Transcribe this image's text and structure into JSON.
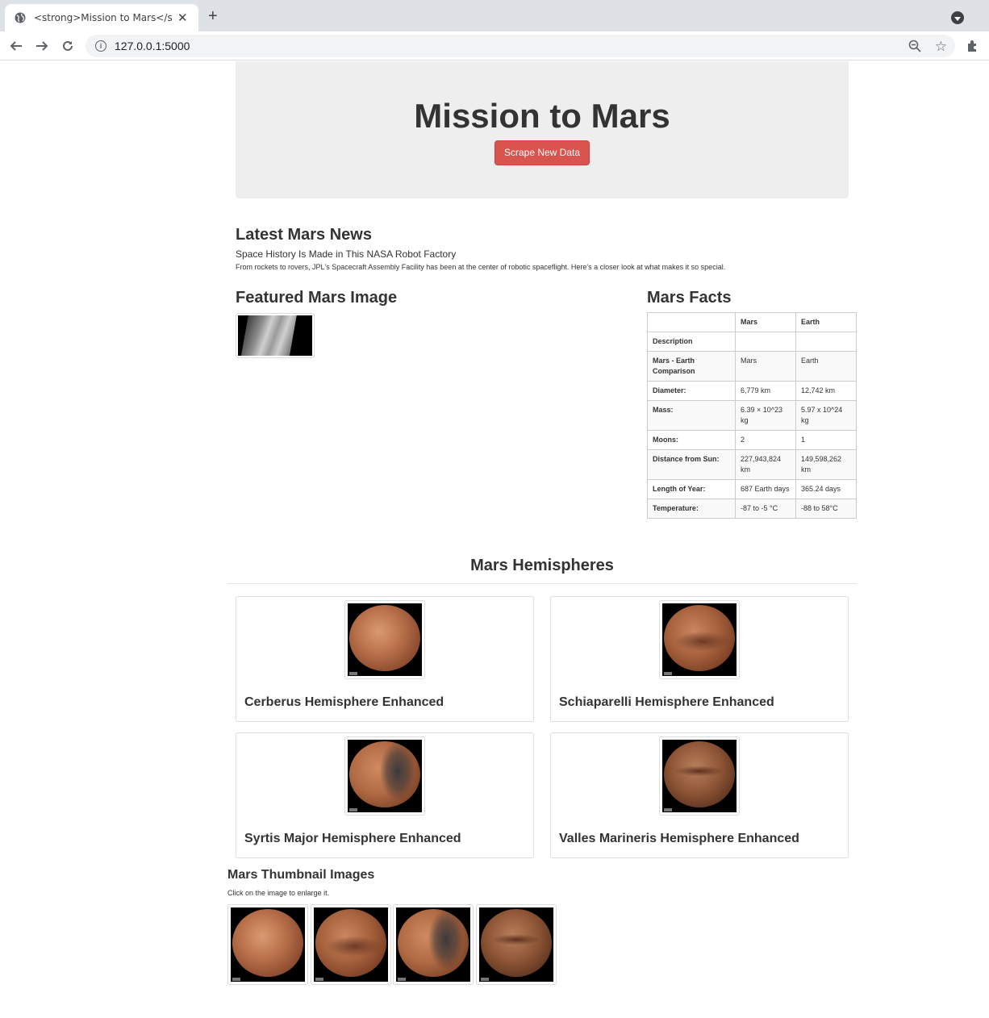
{
  "browser": {
    "tab_title": "<strong>Mission to Mars</strong>",
    "url": "127.0.0.1:5000"
  },
  "jumbotron": {
    "title": "Mission to Mars",
    "button_label": "Scrape New Data"
  },
  "news": {
    "heading": "Latest Mars News",
    "title": "Space History Is Made in This NASA Robot Factory",
    "paragraph": "From rockets to rovers, JPL's Spacecraft Assembly Facility has been at the center of robotic spaceflight. Here's a closer look at what makes it so special."
  },
  "featured": {
    "heading": "Featured Mars Image"
  },
  "facts": {
    "heading": "Mars Facts",
    "columns": [
      "",
      "Mars",
      "Earth"
    ],
    "rows": [
      [
        "Description",
        "",
        ""
      ],
      [
        "Mars - Earth Comparison",
        "Mars",
        "Earth"
      ],
      [
        "Diameter:",
        "6,779 km",
        "12,742 km"
      ],
      [
        "Mass:",
        "6.39 × 10^23 kg",
        "5.97 x 10^24 kg"
      ],
      [
        "Moons:",
        "2",
        "1"
      ],
      [
        "Distance from Sun:",
        "227,943,824 km",
        "149,598,262 km"
      ],
      [
        "Length of Year:",
        "687 Earth days",
        "365.24 days"
      ],
      [
        "Temperature:",
        "-87 to -5 °C",
        "-88 to 58°C"
      ]
    ]
  },
  "hemispheres": {
    "heading": "Mars Hemispheres",
    "items": [
      {
        "title": "Cerberus Hemisphere Enhanced"
      },
      {
        "title": "Schiaparelli Hemisphere Enhanced"
      },
      {
        "title": "Syrtis Major Hemisphere Enhanced"
      },
      {
        "title": "Valles Marineris Hemisphere Enhanced"
      }
    ]
  },
  "thumbnails": {
    "heading": "Mars Thumbnail Images",
    "note": "Click on the image to enlarge it."
  }
}
